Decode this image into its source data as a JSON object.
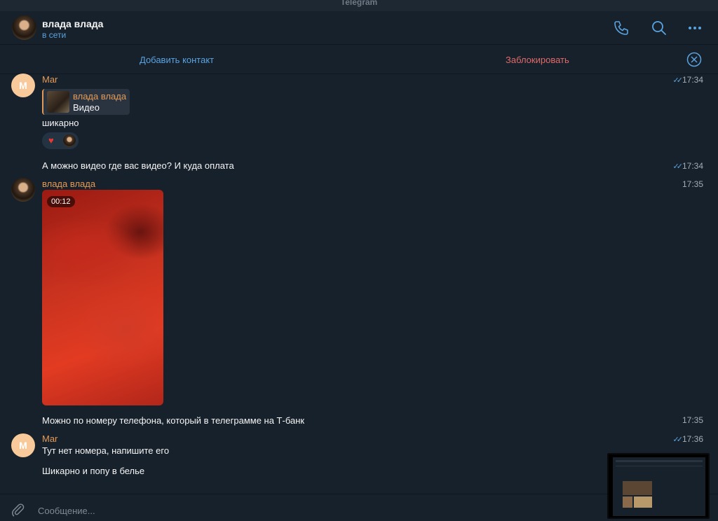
{
  "window": {
    "title": "Telegram"
  },
  "header": {
    "name": "влада влада",
    "status": "в сети",
    "icons": [
      "phone-icon",
      "search-icon",
      "more-icon"
    ]
  },
  "action_bar": {
    "add_contact": "Добавить контакт",
    "block": "Заблокировать"
  },
  "messages": [
    {
      "sender": "Mar",
      "avatar_letter": "M",
      "time": "17:34",
      "reply": {
        "name": "влада влада",
        "text": "Видео"
      },
      "text": "шикарно",
      "reaction": "❤️"
    },
    {
      "text": "А можно видео где вас видео? И куда оплата",
      "time": "17:34"
    },
    {
      "sender": "влада влада",
      "time": "17:35",
      "video_duration": "00:12"
    },
    {
      "text": "Можно по номеру телефона, который в телеграмме на Т-банк",
      "time": "17:35"
    },
    {
      "sender": "Mar",
      "avatar_letter": "M",
      "time": "17:36",
      "text": "Тут нет номера, напишите его"
    },
    {
      "text": "Шикарно и попу в белье"
    }
  ],
  "composer": {
    "placeholder": "Сообщение..."
  },
  "colors": {
    "background": "#17212b",
    "accent": "#5aa3e0",
    "sender": "#e49a56",
    "danger": "#e06a6a"
  }
}
